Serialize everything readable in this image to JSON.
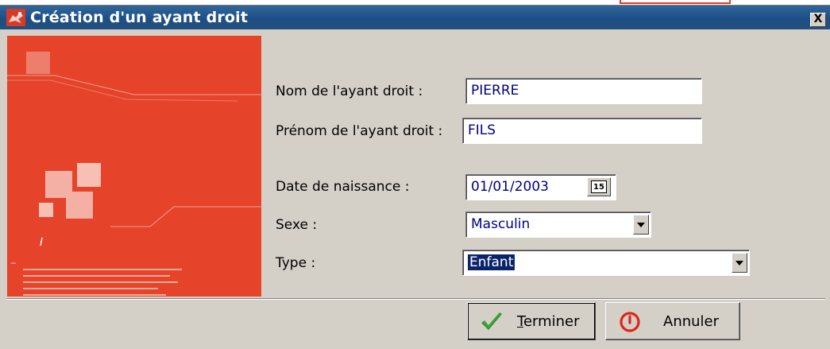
{
  "window": {
    "title": "Création d'un ayant droit",
    "close_label": "X"
  },
  "form": {
    "nom": {
      "label": "Nom de l'ayant droit :",
      "value": "PIERRE"
    },
    "prenom": {
      "label": "Prénom de l'ayant droit :",
      "value": "FILS"
    },
    "date": {
      "label": "Date de naissance :",
      "value": "01/01/2003",
      "calendar_icon_text": "15"
    },
    "sexe": {
      "label": "Sexe :",
      "value": "Masculin"
    },
    "type": {
      "label": "Type :",
      "value": "Enfant"
    }
  },
  "buttons": {
    "terminer": {
      "mnemonic": "T",
      "rest": "erminer"
    },
    "annuler": {
      "label": "Annuler"
    }
  },
  "colors": {
    "titlebar": "#1d4f86",
    "banner": "#e5432a",
    "dialog_bg": "#d4d0c8",
    "field_text": "#000080",
    "selection": "#0a246a"
  },
  "icons": {
    "app": "red-fox-logo-icon",
    "calendar": "calendar-icon",
    "ok": "checkmark-icon",
    "cancel": "power-cancel-icon"
  }
}
